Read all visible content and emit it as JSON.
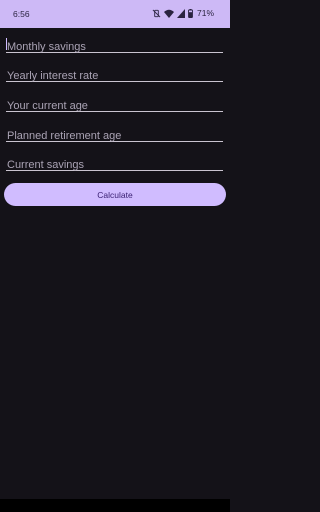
{
  "status_bar": {
    "time": "6:56",
    "battery": "71%",
    "icons": [
      "vibrate-off-icon",
      "wifi-icon",
      "signal-icon",
      "battery-icon"
    ]
  },
  "form": {
    "monthly_savings": {
      "value": "",
      "placeholder": "Monthly savings"
    },
    "interest_rate": {
      "value": "",
      "placeholder": "Yearly interest rate"
    },
    "current_age": {
      "value": "",
      "placeholder": "Your current age"
    },
    "retirement_age": {
      "value": "",
      "placeholder": "Planned retirement age"
    },
    "current_savings": {
      "value": "",
      "placeholder": "Current savings"
    }
  },
  "calculate_label": "Calculate",
  "colors": {
    "background": "#141218",
    "status_bar": "#cdb9f6",
    "accent": "#d0bcff",
    "button_text": "#381e72"
  }
}
